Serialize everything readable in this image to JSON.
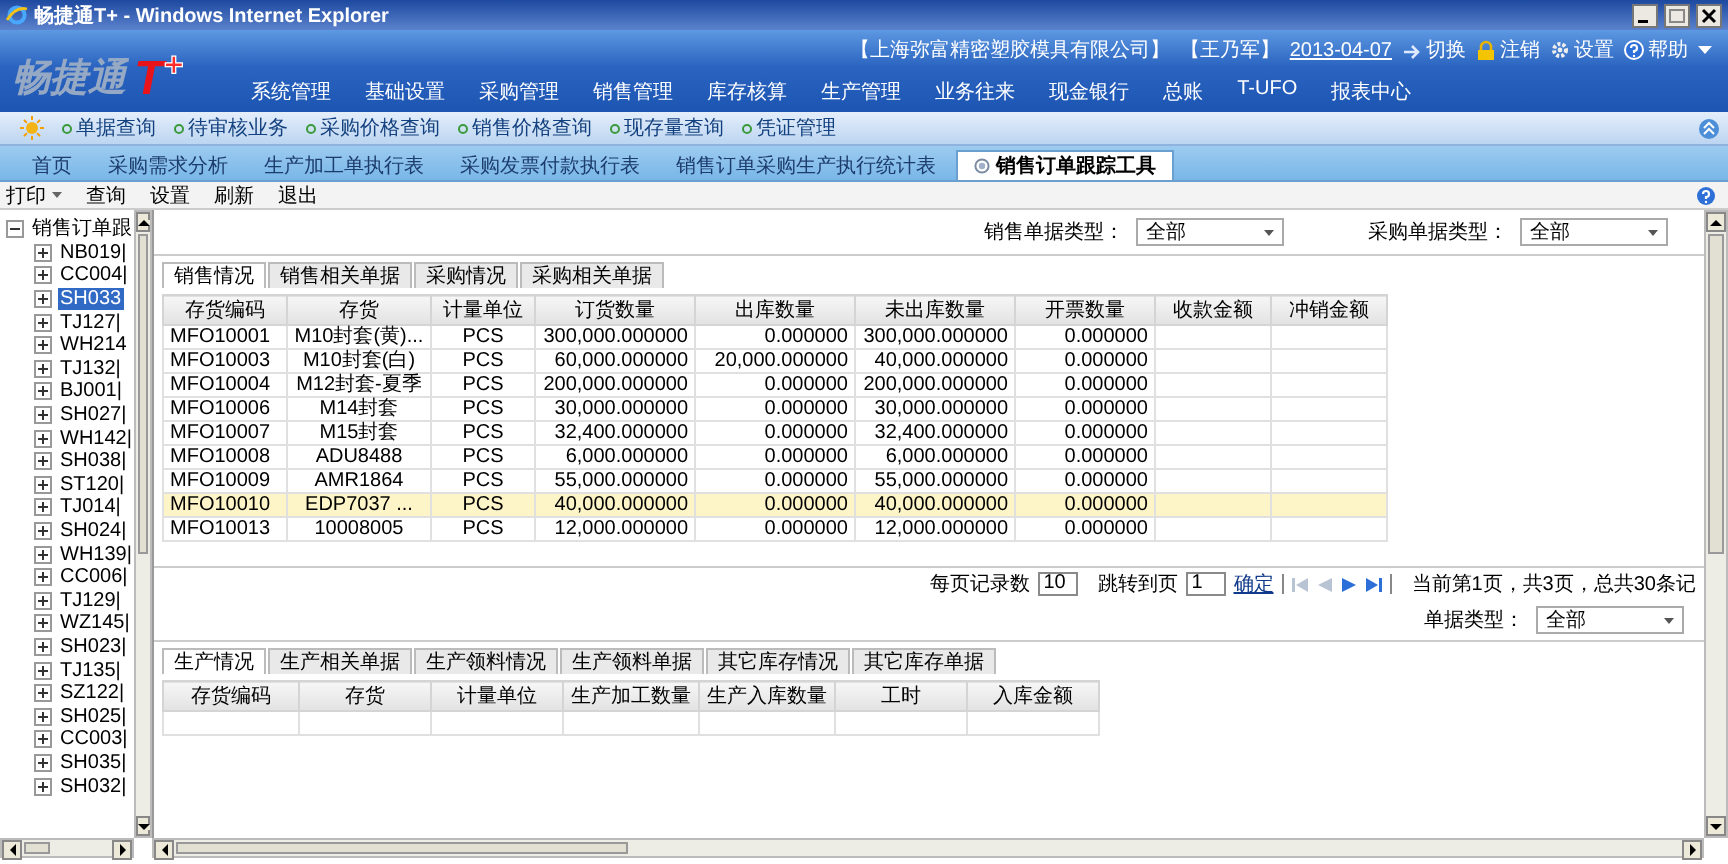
{
  "window": {
    "title": "畅捷通T+ - Windows Internet Explorer"
  },
  "header": {
    "logo": "畅捷通",
    "logo_mark": "T$^{+}$",
    "company": "【上海弥富精密塑胶模具有限公司】",
    "user": "【王乃军】",
    "date": "2013-04-07",
    "actions": [
      {
        "kind": "switch",
        "label": "切换"
      },
      {
        "kind": "logout",
        "label": "注销"
      },
      {
        "kind": "settings",
        "label": "设置"
      },
      {
        "kind": "help",
        "label": "帮助"
      }
    ],
    "nav": [
      "系统管理",
      "基础设置",
      "采购管理",
      "销售管理",
      "库存核算",
      "生产管理",
      "业务往来",
      "现金银行",
      "总账",
      "T-UFO",
      "报表中心"
    ]
  },
  "quick_links": [
    "单据查询",
    "待审核业务",
    "采购价格查询",
    "销售价格查询",
    "现存量查询",
    "凭证管理"
  ],
  "tabs": [
    {
      "label": "首页",
      "selected": false
    },
    {
      "label": "采购需求分析",
      "selected": false
    },
    {
      "label": "生产加工单执行表",
      "selected": false
    },
    {
      "label": "采购发票付款执行表",
      "selected": false
    },
    {
      "label": "销售订单采购生产执行统计表",
      "selected": false
    },
    {
      "label": "销售订单跟踪工具",
      "selected": true
    }
  ],
  "toolbar": [
    {
      "label": "打印",
      "kind": "menu"
    },
    {
      "label": "查询",
      "kind": "button"
    },
    {
      "label": "设置",
      "kind": "button"
    },
    {
      "label": "刷新",
      "kind": "button"
    },
    {
      "label": "退出",
      "kind": "button"
    }
  ],
  "tree": {
    "label": "销售订单跟",
    "expanded": true,
    "children": [
      {
        "label": "NB019|",
        "expanded": false,
        "selected": false
      },
      {
        "label": "CC004|",
        "expanded": false,
        "selected": false
      },
      {
        "label": "SH033",
        "expanded": false,
        "selected": true
      },
      {
        "label": "TJ127|",
        "expanded": false,
        "selected": false
      },
      {
        "label": "WH214",
        "expanded": false,
        "selected": false
      },
      {
        "label": "TJ132|",
        "expanded": false,
        "selected": false
      },
      {
        "label": "BJ001|",
        "expanded": false,
        "selected": false
      },
      {
        "label": "SH027|",
        "expanded": false,
        "selected": false
      },
      {
        "label": "WH142|",
        "expanded": false,
        "selected": false
      },
      {
        "label": "SH038|",
        "expanded": false,
        "selected": false
      },
      {
        "label": "ST120|",
        "expanded": false,
        "selected": false
      },
      {
        "label": "TJ014|",
        "expanded": false,
        "selected": false
      },
      {
        "label": "SH024|",
        "expanded": false,
        "selected": false
      },
      {
        "label": "WH139|",
        "expanded": false,
        "selected": false
      },
      {
        "label": "CC006|",
        "expanded": false,
        "selected": false
      },
      {
        "label": "TJ129|",
        "expanded": false,
        "selected": false
      },
      {
        "label": "WZ145|",
        "expanded": false,
        "selected": false
      },
      {
        "label": "SH023|",
        "expanded": false,
        "selected": false
      },
      {
        "label": "TJ135|",
        "expanded": false,
        "selected": false
      },
      {
        "label": "SZ122|",
        "expanded": false,
        "selected": false
      },
      {
        "label": "SH025|",
        "expanded": false,
        "selected": false
      },
      {
        "label": "CC003|",
        "expanded": false,
        "selected": false
      },
      {
        "label": "SH035|",
        "expanded": false,
        "selected": false
      },
      {
        "label": "SH032|",
        "expanded": false,
        "selected": false
      }
    ]
  },
  "filters": [
    {
      "label": "销售单据类型：",
      "value": "全部"
    },
    {
      "label": "采购单据类型：",
      "value": "全部"
    }
  ],
  "top_grid": {
    "tabs": [
      {
        "label": "销售情况",
        "selected": true
      },
      {
        "label": "销售相关单据",
        "selected": false
      },
      {
        "label": "采购情况",
        "selected": false
      },
      {
        "label": "采购相关单据",
        "selected": false
      }
    ],
    "columns": [
      "存货编码",
      "存货",
      "计量单位",
      "订货数量",
      "出库数量",
      "未出库数量",
      "开票数量",
      "收款金额",
      "冲销金额"
    ],
    "rows": [
      {
        "cells": [
          "MFO10001",
          "M10封套(黄)...",
          "PCS",
          "300,000.000000",
          "0.000000",
          "300,000.000000",
          "0.000000"
        ],
        "selected": false
      },
      {
        "cells": [
          "MFO10003",
          "M10封套(白)",
          "PCS",
          "60,000.000000",
          "20,000.000000",
          "40,000.000000",
          "0.000000"
        ],
        "selected": false
      },
      {
        "cells": [
          "MFO10004",
          "M12封套-夏季",
          "PCS",
          "200,000.000000",
          "0.000000",
          "200,000.000000",
          "0.000000"
        ],
        "selected": false
      },
      {
        "cells": [
          "MFO10006",
          "M14封套",
          "PCS",
          "30,000.000000",
          "0.000000",
          "30,000.000000",
          "0.000000"
        ],
        "selected": false
      },
      {
        "cells": [
          "MFO10007",
          "M15封套",
          "PCS",
          "32,400.000000",
          "0.000000",
          "32,400.000000",
          "0.000000"
        ],
        "selected": false
      },
      {
        "cells": [
          "MFO10008",
          "ADU8488",
          "PCS",
          "6,000.000000",
          "0.000000",
          "6,000.000000",
          "0.000000"
        ],
        "selected": false
      },
      {
        "cells": [
          "MFO10009",
          "AMR1864",
          "PCS",
          "55,000.000000",
          "0.000000",
          "55,000.000000",
          "0.000000"
        ],
        "selected": false
      },
      {
        "cells": [
          "MFO10010",
          "EDP7037 ...",
          "PCS",
          "40,000.000000",
          "0.000000",
          "40,000.000000",
          "0.000000"
        ],
        "selected": true
      },
      {
        "cells": [
          "MFO10013",
          "10008005",
          "PCS",
          "12,000.000000",
          "0.000000",
          "12,000.000000",
          "0.000000"
        ],
        "selected": false
      }
    ]
  },
  "pager": {
    "page_size_label": "每页记录数",
    "page_size": "10",
    "goto_label": "跳转到页",
    "goto_page": "1",
    "confirm": "确定",
    "nav": [
      {
        "kind": "first",
        "disabled": true
      },
      {
        "kind": "prev",
        "disabled": true
      },
      {
        "kind": "next",
        "disabled": false
      },
      {
        "kind": "last",
        "disabled": false
      }
    ],
    "status": "当前第1页，共3页，总共30条记"
  },
  "bottom_filter": {
    "label": "单据类型：",
    "value": "全部"
  },
  "bottom_grid": {
    "tabs": [
      {
        "label": "生产情况",
        "selected": true
      },
      {
        "label": "生产相关单据",
        "selected": false
      },
      {
        "label": "生产领料情况",
        "selected": false
      },
      {
        "label": "生产领料单据",
        "selected": false
      },
      {
        "label": "其它库存情况",
        "selected": false
      },
      {
        "label": "其它库存单据",
        "selected": false
      }
    ],
    "columns": [
      "存货编码",
      "存货",
      "计量单位",
      "生产加工数量",
      "生产入库数量",
      "工时",
      "入库金额"
    ]
  }
}
